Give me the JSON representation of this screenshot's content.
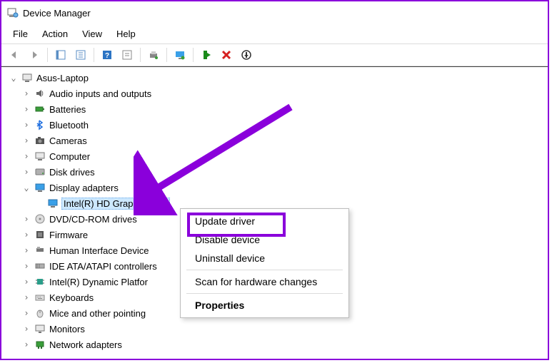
{
  "window": {
    "title": "Device Manager"
  },
  "menu": {
    "file": "File",
    "action": "Action",
    "view": "View",
    "help": "Help"
  },
  "tree": {
    "root": "Asus-Laptop",
    "items": [
      {
        "label": "Audio inputs and outputs"
      },
      {
        "label": "Batteries"
      },
      {
        "label": "Bluetooth"
      },
      {
        "label": "Cameras"
      },
      {
        "label": "Computer"
      },
      {
        "label": "Disk drives"
      },
      {
        "label": "Display adapters",
        "expanded": true,
        "children": [
          {
            "label": "Intel(R) HD Graphics 620",
            "selected": true
          }
        ]
      },
      {
        "label": "DVD/CD-ROM drives"
      },
      {
        "label": "Firmware"
      },
      {
        "label": "Human Interface Device"
      },
      {
        "label": "IDE ATA/ATAPI controllers"
      },
      {
        "label": "Intel(R) Dynamic Platfor"
      },
      {
        "label": "Keyboards"
      },
      {
        "label": "Mice and other pointing"
      },
      {
        "label": "Monitors"
      },
      {
        "label": "Network adapters"
      }
    ]
  },
  "context_menu": {
    "update": "Update driver",
    "disable": "Disable device",
    "uninstall": "Uninstall device",
    "scan": "Scan for hardware changes",
    "properties": "Properties"
  },
  "annotation": {
    "highlight_color": "#8a00db"
  }
}
